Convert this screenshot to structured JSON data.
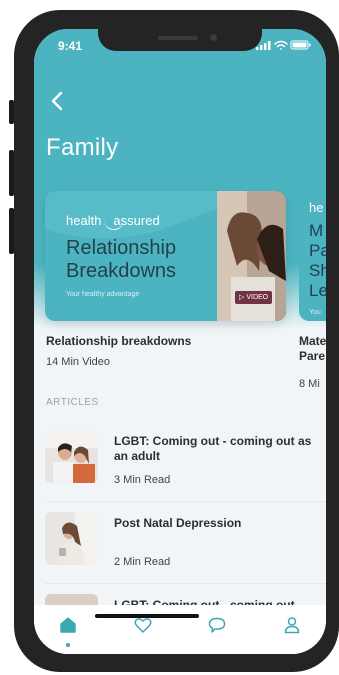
{
  "status_bar": {
    "time": "9:41"
  },
  "header": {
    "title": "Family"
  },
  "featured": [
    {
      "brand": "health assured",
      "brand_left": "health",
      "brand_right": "assured",
      "card_title_1": "Relationship",
      "card_title_2": "Breakdowns",
      "tagline": "Your healthy advantage",
      "badge": "VIDEO",
      "title": "Relationship breakdowns",
      "meta": "14 Min Video"
    },
    {
      "brand": "he",
      "card_title_1": "M",
      "card_title_2": "Pa",
      "card_title_3": "Sh",
      "card_title_4": "Le",
      "tagline": "You",
      "title_1": "Mate",
      "title_2": "Pare",
      "meta": "8 Mi"
    }
  ],
  "articles": {
    "heading": "ARTICLES",
    "items": [
      {
        "title": "LGBT: Coming out - coming out as an adult",
        "meta": "3 Min Read"
      },
      {
        "title": "Post Natal Depression",
        "meta": "2 Min Read"
      },
      {
        "title": "LGBT: Coming out - coming out"
      }
    ]
  },
  "tab_bar": {
    "items": [
      "home-icon",
      "heart-icon",
      "chat-icon",
      "profile-icon"
    ],
    "active": "home-icon"
  },
  "colors": {
    "accent": "#4bb4c0",
    "background": "#f1f5f8",
    "text": "#2a2f33"
  }
}
